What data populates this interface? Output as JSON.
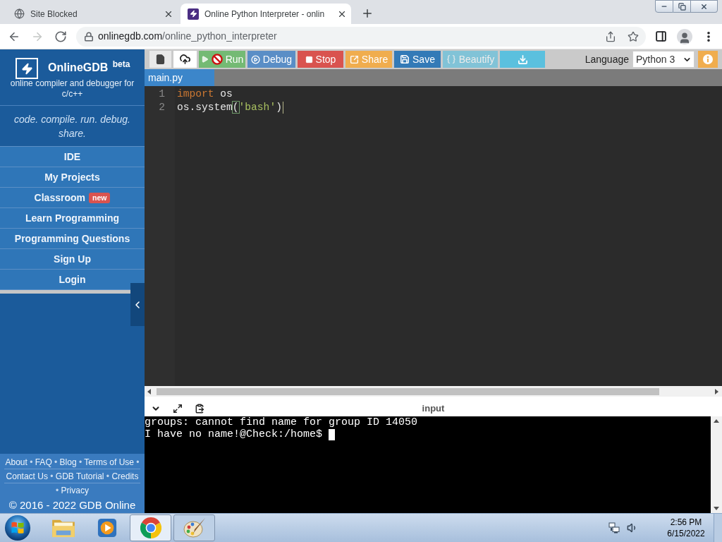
{
  "browser": {
    "tabs": [
      {
        "kind": "globe",
        "title": "Site Blocked",
        "selected": false
      },
      {
        "kind": "site",
        "title": "Online Python Interpreter - onlin",
        "selected": true
      }
    ],
    "navigation": [
      {
        "kind": "back",
        "disabled": false
      },
      {
        "kind": "forward",
        "disabled": true
      },
      {
        "kind": "reload",
        "disabled": false
      }
    ],
    "address": {
      "host": "onlinegdb.com",
      "path": "/online_python_interpreter"
    }
  },
  "sidebar": {
    "brand": "OnlineGDB $^{beta}$",
    "subtitle": "online compiler and debugger for c/c++",
    "tagline": "code. compile. run. debug. share.",
    "nav": [
      {
        "label": "IDE"
      },
      {
        "label": "My Projects"
      },
      {
        "label": "Classroom",
        "badge": "new"
      },
      {
        "label": "Learn Programming"
      },
      {
        "label": "Programming Questions"
      },
      {
        "label": "Sign Up"
      },
      {
        "label": "Login"
      }
    ],
    "footer": {
      "items": [
        {
          "kind": "link",
          "text": "About"
        },
        {
          "kind": "separator",
          "text": "•"
        },
        {
          "kind": "link",
          "text": "FAQ"
        },
        {
          "kind": "separator",
          "text": "•"
        },
        {
          "kind": "link",
          "text": "Blog"
        },
        {
          "kind": "separator",
          "text": "•"
        },
        {
          "kind": "link",
          "text": "Terms of Use"
        },
        {
          "kind": "separator",
          "text": "•"
        },
        {
          "kind": "link",
          "text": "Contact Us"
        },
        {
          "kind": "separator",
          "text": "•"
        },
        {
          "kind": "link",
          "text": "GDB Tutorial"
        },
        {
          "kind": "separator",
          "text": "•"
        },
        {
          "kind": "link",
          "text": "Credits"
        },
        {
          "kind": "separator",
          "text": "•"
        },
        {
          "kind": "link",
          "text": "Privacy"
        }
      ],
      "copyright": "© 2016 - 2022 GDB Online"
    }
  },
  "toolbar": {
    "buttons": [
      {
        "kind": "new-file",
        "disabled": false
      },
      {
        "kind": "upload",
        "disabled": false
      },
      {
        "kind": "run",
        "label": "Run",
        "disabled": false
      },
      {
        "kind": "debug",
        "label": "Debug",
        "disabled": false
      },
      {
        "kind": "stop",
        "label": "Stop",
        "disabled": false
      },
      {
        "kind": "share",
        "label": "Share",
        "disabled": false
      },
      {
        "kind": "save",
        "label": "Save",
        "disabled": false
      },
      {
        "kind": "beautify",
        "label": "Beautify",
        "disabled": true
      },
      {
        "kind": "download",
        "disabled": false
      }
    ],
    "language": {
      "label": "Language",
      "value": "Python 3"
    }
  },
  "editor": {
    "tabs": [
      {
        "name": "main.py",
        "selected": true
      }
    ],
    "lines": [
      {
        "number": "1",
        "cursor": false,
        "tokens": [
          {
            "kind": "keyword",
            "text": "import"
          },
          {
            "kind": "plain",
            "text": " os"
          }
        ]
      },
      {
        "number": "2",
        "cursor": true,
        "tokens": [
          {
            "kind": "plain",
            "text": "os.system"
          },
          {
            "kind": "bracket-match",
            "text": "("
          },
          {
            "kind": "string",
            "text": "'bash'"
          },
          {
            "kind": "plain",
            "text": ")"
          }
        ]
      }
    ]
  },
  "output": {
    "title": "input",
    "lines": [
      {
        "text": "groups: cannot find name for group ID 14050",
        "cursor": false
      },
      {
        "text": "I have no name!@Check:/home$",
        "cursor": true
      }
    ]
  },
  "taskbar": {
    "apps": [
      {
        "kind": "explorer",
        "running": false,
        "selected": false
      },
      {
        "kind": "media-player",
        "running": false,
        "selected": false
      },
      {
        "kind": "chrome",
        "running": true,
        "selected": true
      },
      {
        "kind": "paint",
        "running": true,
        "selected": false
      }
    ],
    "time": "2:56 PM",
    "date": "6/15/2022"
  }
}
